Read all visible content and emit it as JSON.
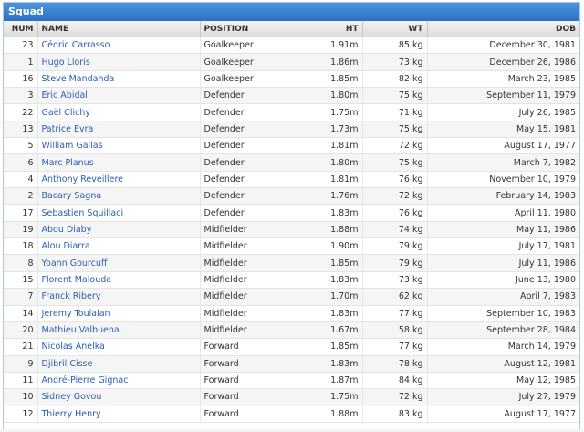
{
  "panel": {
    "title": "Squad"
  },
  "columns": [
    "NUM",
    "NAME",
    "POSITION",
    "HT",
    "WT",
    "DOB"
  ],
  "rows": [
    [
      "23",
      "Cédric Carrasso",
      "Goalkeeper",
      "1.91m",
      "85 kg",
      "December 30, 1981"
    ],
    [
      "1",
      "Hugo Lloris",
      "Goalkeeper",
      "1.86m",
      "73 kg",
      "December 26, 1986"
    ],
    [
      "16",
      "Steve Mandanda",
      "Goalkeeper",
      "1.85m",
      "82 kg",
      "March 23, 1985"
    ],
    [
      "3",
      "Eric Abidal",
      "Defender",
      "1.80m",
      "75 kg",
      "September 11, 1979"
    ],
    [
      "22",
      "Gaël Clichy",
      "Defender",
      "1.75m",
      "71 kg",
      "July 26, 1985"
    ],
    [
      "13",
      "Patrice Evra",
      "Defender",
      "1.73m",
      "75 kg",
      "May 15, 1981"
    ],
    [
      "5",
      "William Gallas",
      "Defender",
      "1.81m",
      "72 kg",
      "August 17, 1977"
    ],
    [
      "6",
      "Marc Planus",
      "Defender",
      "1.80m",
      "75 kg",
      "March 7, 1982"
    ],
    [
      "4",
      "Anthony Reveillere",
      "Defender",
      "1.81m",
      "76 kg",
      "November 10, 1979"
    ],
    [
      "2",
      "Bacary Sagna",
      "Defender",
      "1.76m",
      "72 kg",
      "February 14, 1983"
    ],
    [
      "17",
      "Sebastien Squillaci",
      "Defender",
      "1.83m",
      "76 kg",
      "April 11, 1980"
    ],
    [
      "19",
      "Abou Diaby",
      "Midfielder",
      "1.88m",
      "74 kg",
      "May 11, 1986"
    ],
    [
      "18",
      "Alou Diarra",
      "Midfielder",
      "1.90m",
      "79 kg",
      "July 17, 1981"
    ],
    [
      "8",
      "Yoann Gourcuff",
      "Midfielder",
      "1.85m",
      "79 kg",
      "July 11, 1986"
    ],
    [
      "15",
      "Florent Malouda",
      "Midfielder",
      "1.83m",
      "73 kg",
      "June 13, 1980"
    ],
    [
      "7",
      "Franck Ribery",
      "Midfielder",
      "1.70m",
      "62 kg",
      "April 7, 1983"
    ],
    [
      "14",
      "Jeremy Toulalan",
      "Midfielder",
      "1.83m",
      "77 kg",
      "September 10, 1983"
    ],
    [
      "20",
      "Mathieu Valbuena",
      "Midfielder",
      "1.67m",
      "58 kg",
      "September 28, 1984"
    ],
    [
      "21",
      "Nicolas Anelka",
      "Forward",
      "1.85m",
      "77 kg",
      "March 14, 1979"
    ],
    [
      "9",
      "Djibril Cisse",
      "Forward",
      "1.83m",
      "78 kg",
      "August 12, 1981"
    ],
    [
      "11",
      "André-Pierre Gignac",
      "Forward",
      "1.87m",
      "84 kg",
      "May 12, 1985"
    ],
    [
      "10",
      "Sidney Govou",
      "Forward",
      "1.75m",
      "72 kg",
      "July 27, 1979"
    ],
    [
      "12",
      "Thierry Henry",
      "Forward",
      "1.88m",
      "83 kg",
      "August 17, 1977"
    ]
  ]
}
